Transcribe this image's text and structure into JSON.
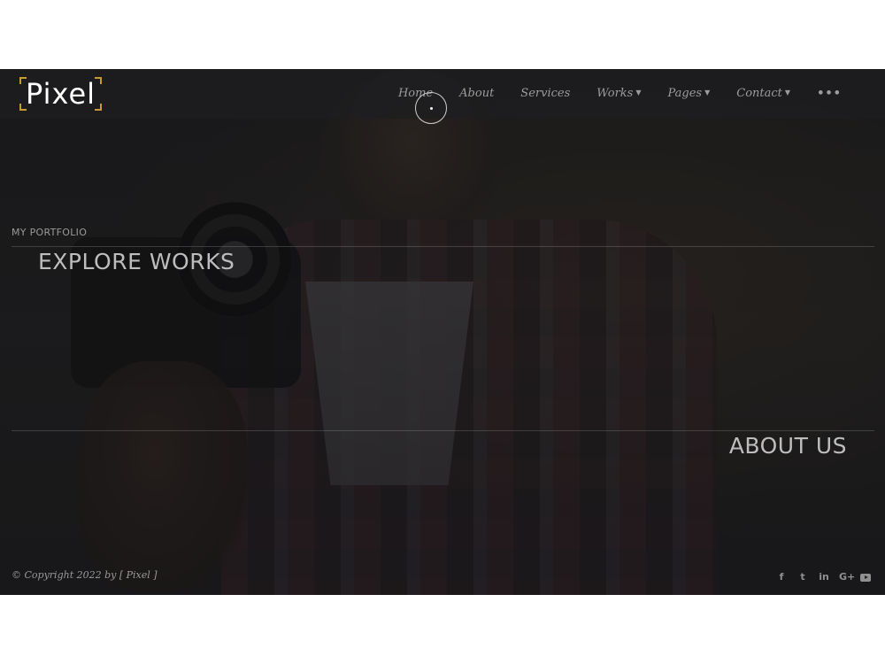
{
  "brand": {
    "logo_text": "Pixel"
  },
  "nav": {
    "items": [
      {
        "label": "Home",
        "has_dropdown": false
      },
      {
        "label": "About",
        "has_dropdown": false
      },
      {
        "label": "Services",
        "has_dropdown": false
      },
      {
        "label": "Works",
        "has_dropdown": true
      },
      {
        "label": "Pages",
        "has_dropdown": true
      },
      {
        "label": "Contact",
        "has_dropdown": true
      }
    ],
    "more": "•••"
  },
  "portfolio": {
    "kicker": "MY PORTFOLIO",
    "explore_heading": "EXPLORE WORKS",
    "about_heading": "ABOUT US"
  },
  "footer": {
    "copyright": "© Copyright 2022 by [ Pixel ]",
    "social": [
      {
        "icon": "facebook-icon",
        "glyph": "f"
      },
      {
        "icon": "twitter-icon",
        "glyph": "t"
      },
      {
        "icon": "linkedin-icon",
        "glyph": "in"
      },
      {
        "icon": "google-plus-icon",
        "glyph": "G+"
      },
      {
        "icon": "youtube-icon",
        "glyph": ""
      }
    ]
  },
  "colors": {
    "accent": "#c99a2e",
    "page_bg": "#ffffff",
    "overlay": "#1e1e20"
  }
}
